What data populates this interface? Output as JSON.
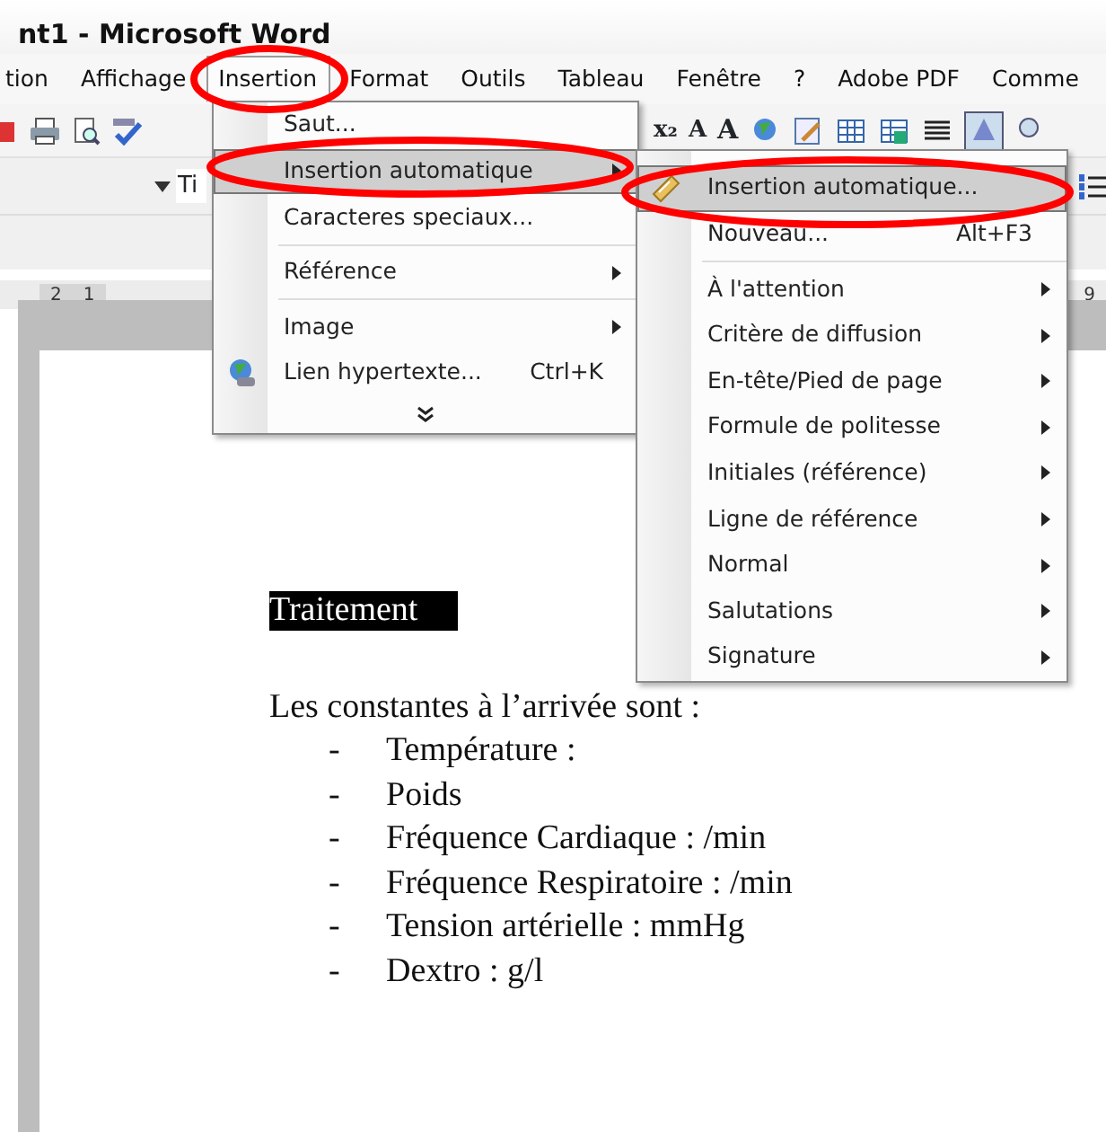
{
  "window": {
    "title": "nt1 - Microsoft Word"
  },
  "menu_bar": [
    {
      "label": "tion",
      "selected": false
    },
    {
      "label": "Affichage",
      "selected": false
    },
    {
      "label": "Insertion",
      "selected": true
    },
    {
      "label": "Format",
      "selected": false
    },
    {
      "label": "Outils",
      "selected": false
    },
    {
      "label": "Tableau",
      "selected": false
    },
    {
      "label": "Fenêtre",
      "selected": false
    },
    {
      "label": "?",
      "selected": false
    },
    {
      "label": "Adobe PDF",
      "selected": false
    },
    {
      "label": "Comme",
      "selected": false
    }
  ],
  "format_bar": {
    "style_value": "Ti"
  },
  "toolbar_glyphs": [
    "x₂",
    "A",
    "A"
  ],
  "ruler": {
    "left_marks": [
      "2",
      "1"
    ],
    "right_marks": [
      "9"
    ]
  },
  "insertion_menu": [
    {
      "kind": "item",
      "label": "Saut...",
      "selected": false,
      "submenu": false,
      "icon": false
    },
    {
      "kind": "item",
      "label": "Insertion automatique",
      "selected": true,
      "submenu": true,
      "icon": false
    },
    {
      "kind": "item",
      "label": "Caracteres speciaux...",
      "selected": false,
      "submenu": false,
      "icon": false
    },
    {
      "kind": "separator"
    },
    {
      "kind": "item",
      "label": "Référence",
      "selected": false,
      "submenu": true,
      "icon": false
    },
    {
      "kind": "separator"
    },
    {
      "kind": "item",
      "label": "Image",
      "selected": false,
      "submenu": true,
      "icon": false
    },
    {
      "kind": "item",
      "label": "Lien hypertexte...",
      "shortcut": "Ctrl+K",
      "selected": false,
      "submenu": false,
      "icon": true
    },
    {
      "kind": "more"
    }
  ],
  "autotext_menu": [
    {
      "kind": "item",
      "label": "Insertion automatique...",
      "selected": true,
      "submenu": false,
      "icon": true
    },
    {
      "kind": "item",
      "label": "Nouveau...",
      "shortcut": "Alt+F3",
      "selected": false,
      "submenu": false,
      "icon": false
    },
    {
      "kind": "separator"
    },
    {
      "kind": "item",
      "label": "À l'attention",
      "selected": false,
      "submenu": true,
      "icon": false
    },
    {
      "kind": "item",
      "label": "Critère de diffusion",
      "selected": false,
      "submenu": true,
      "icon": false
    },
    {
      "kind": "item",
      "label": "En-tête/Pied de page",
      "selected": false,
      "submenu": true,
      "icon": false
    },
    {
      "kind": "item",
      "label": "Formule de politesse",
      "selected": false,
      "submenu": true,
      "icon": false
    },
    {
      "kind": "item",
      "label": "Initiales (référence)",
      "selected": false,
      "submenu": true,
      "icon": false
    },
    {
      "kind": "item",
      "label": "Ligne de référence",
      "selected": false,
      "submenu": true,
      "icon": false
    },
    {
      "kind": "item",
      "label": "Normal",
      "selected": false,
      "submenu": true,
      "icon": false
    },
    {
      "kind": "item",
      "label": "Salutations",
      "selected": false,
      "submenu": true,
      "icon": false
    },
    {
      "kind": "item",
      "label": "Signature",
      "selected": false,
      "submenu": true,
      "icon": false
    }
  ],
  "document": {
    "heading": "Traitement",
    "heading_selected": true,
    "paragraph": "Les constantes à l’arrivée sont :",
    "list": [
      {
        "bullet": "-",
        "text": "Température :"
      },
      {
        "bullet": "-",
        "text": "Poids"
      },
      {
        "bullet": "-",
        "text": "Fréquence Cardiaque : /min"
      },
      {
        "bullet": "-",
        "text": "Fréquence Respiratoire : /min"
      },
      {
        "bullet": "-",
        "text": "Tension artérielle : mmHg"
      },
      {
        "bullet": "-",
        "text": "Dextro : g/l"
      }
    ]
  }
}
